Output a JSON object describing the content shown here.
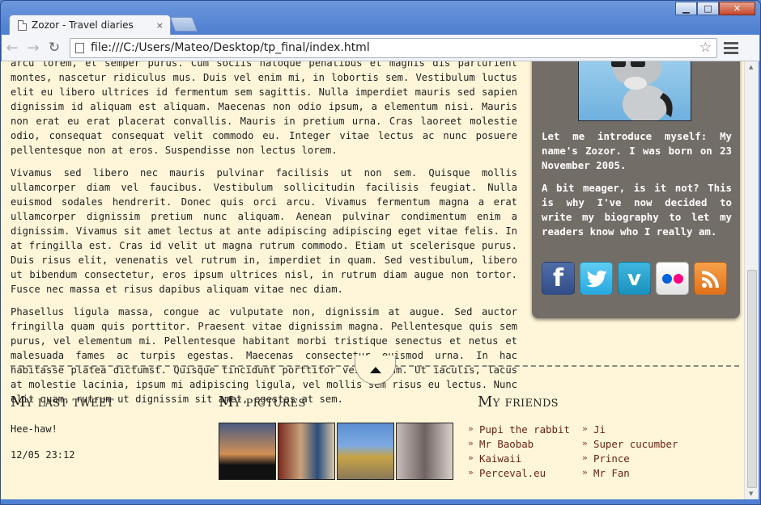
{
  "browser": {
    "tab_title": "Zozor - Travel diaries",
    "tab_close": "×",
    "url": "file:///C:/Users/Mateo/Desktop/tp_final/index.html",
    "window_buttons": {
      "minimize": "▁",
      "maximize": "□",
      "close": "✕"
    }
  },
  "article": {
    "paragraphs": [
      "arcu lorem, et semper purus. Cum sociis natoque penatibus et magnis dis parturient montes, nascetur ridiculus mus. Duis vel enim mi, in lobortis sem. Vestibulum luctus elit eu libero ultrices id fermentum sem sagittis. Nulla imperdiet mauris sed sapien dignissim id aliquam est aliquam. Maecenas non odio ipsum, a elementum nisi. Mauris non erat eu erat placerat convallis. Mauris in pretium urna. Cras laoreet molestie odio, consequat consequat velit commodo eu. Integer vitae lectus ac nunc posuere pellentesque non at eros. Suspendisse non lectus lorem.",
      "Vivamus sed libero nec mauris pulvinar facilisis ut non sem. Quisque mollis ullamcorper diam vel faucibus. Vestibulum sollicitudin facilisis feugiat. Nulla euismod sodales hendrerit. Donec quis orci arcu. Vivamus fermentum magna a erat ullamcorper dignissim pretium nunc aliquam. Aenean pulvinar condimentum enim a dignissim. Vivamus sit amet lectus at ante adipiscing adipiscing eget vitae felis. In at fringilla est. Cras id velit ut magna rutrum commodo. Etiam ut scelerisque purus. Duis risus elit, venenatis vel rutrum in, imperdiet in quam. Sed vestibulum, libero ut bibendum consectetur, eros ipsum ultrices nisl, in rutrum diam augue non tortor. Fusce nec massa et risus dapibus aliquam vitae nec diam.",
      "Phasellus ligula massa, congue ac vulputate non, dignissim at augue. Sed auctor fringilla quam quis porttitor. Praesent vitae dignissim magna. Pellentesque quis sem purus, vel elementum mi. Pellentesque habitant morbi tristique senectus et netus et malesuada fames ac turpis egestas. Maecenas consectetur euismod urna. In hac habitasse platea dictumst. Quisque tincidunt porttitor vestibulum. Ut iaculis, lacus at molestie lacinia, ipsum mi adipiscing ligula, vel mollis sem risus eu lectus. Nunc elit quam, rutrum ut dignissim sit amet, egestas at sem."
    ]
  },
  "aside": {
    "intro": "Let me introduce myself: My name's Zozor. I was born on 23 November 2005.",
    "bio": "A bit meager, is it not? This is why I've now decided to write my biography to let my readers know who I really am.",
    "socials": [
      {
        "name": "facebook",
        "glyph": "f"
      },
      {
        "name": "twitter",
        "glyph": ""
      },
      {
        "name": "vimeo",
        "glyph": "v"
      },
      {
        "name": "flickr",
        "glyph": ""
      },
      {
        "name": "rss",
        "glyph": ""
      }
    ]
  },
  "footer": {
    "tweet_heading": "My last tweet",
    "tweet_text": "Hee-haw!",
    "tweet_time": "12/05 23:12",
    "pictures_heading": "My pictures",
    "friends_heading": "My friends",
    "friends_left": [
      "Pupi the rabbit",
      "Mr Baobab",
      "Kaiwaii",
      "Perceval.eu"
    ],
    "friends_right": [
      "Ji",
      "Super cucumber",
      "Prince",
      "Mr Fan"
    ]
  }
}
